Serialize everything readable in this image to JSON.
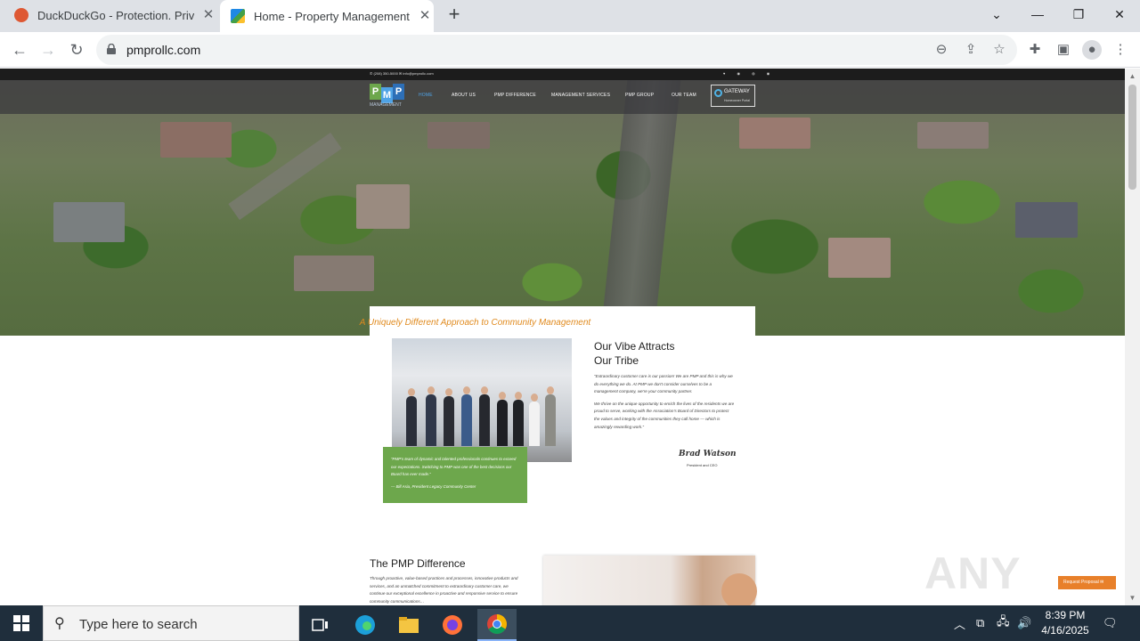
{
  "browser": {
    "tabs": [
      {
        "title": "DuckDuckGo - Protection. Privac",
        "icon": "duckduckgo-favicon"
      },
      {
        "title": "Home - Property Management I",
        "icon": "pmp-favicon",
        "active": true
      }
    ],
    "new_tab": "+",
    "url": "pmprollc.com",
    "window_controls": {
      "minimize": "—",
      "restore": "❐",
      "close": "✕"
    }
  },
  "site": {
    "topbar": {
      "contact": "✆ (208) 350-5000   ✉ info@pmprollc.com",
      "social": "♥ ◉ ◍ ◉"
    },
    "logo": {
      "letters": [
        "P",
        "M",
        "P"
      ],
      "sub": "MANAGEMENT"
    },
    "nav": [
      "HOME",
      "ABOUT US",
      "PMP DIFFERENCE",
      "MANAGEMENT SERVICES",
      "PMP GROUP",
      "OUR TEAM"
    ],
    "gateway": {
      "title": "GATEWAY",
      "sub": "Homeowner Portal"
    },
    "tagline": "A Uniquely Different Approach to Community Management",
    "vibe": {
      "heading_line1": "Our Vibe Attracts",
      "heading_line2": "Our Tribe",
      "para1": "\"Extraordinary customer care is our passion! We are PMP and this is why we do everything we do. At PMP we don't consider ourselves to be a management company, we're your community partner.",
      "para2": "We thrive on the unique opportunity to enrich the lives of the residents we are proud to serve, working with the Association's Board of Directors to protect the values and integrity of the communities they call home — which is amazingly rewarding work.\"",
      "signature": "Brad Watson",
      "signature_role": "President and CEO"
    },
    "testimonial": {
      "quote": "\"PMP's team of dynamic and talented professionals continues to exceed our expectations. Switching to PMP was one of the best decisions our Board has ever made.\"",
      "author": "— Bill Asia, President Legacy Community Center"
    },
    "difference": {
      "heading": "The PMP Difference",
      "para": "Through proactive, value-based practices and processes, innovative products and services, and an unmatched commitment to extraordinary customer care, we continue our exceptional excellence in proactive and responsive service to ensure community communications…"
    },
    "request_proposal": "Request Proposal ✉"
  },
  "watermark": "ANY RUN",
  "taskbar": {
    "search_placeholder": "Type here to search",
    "time": "8:39 PM",
    "date": "4/16/2025"
  }
}
